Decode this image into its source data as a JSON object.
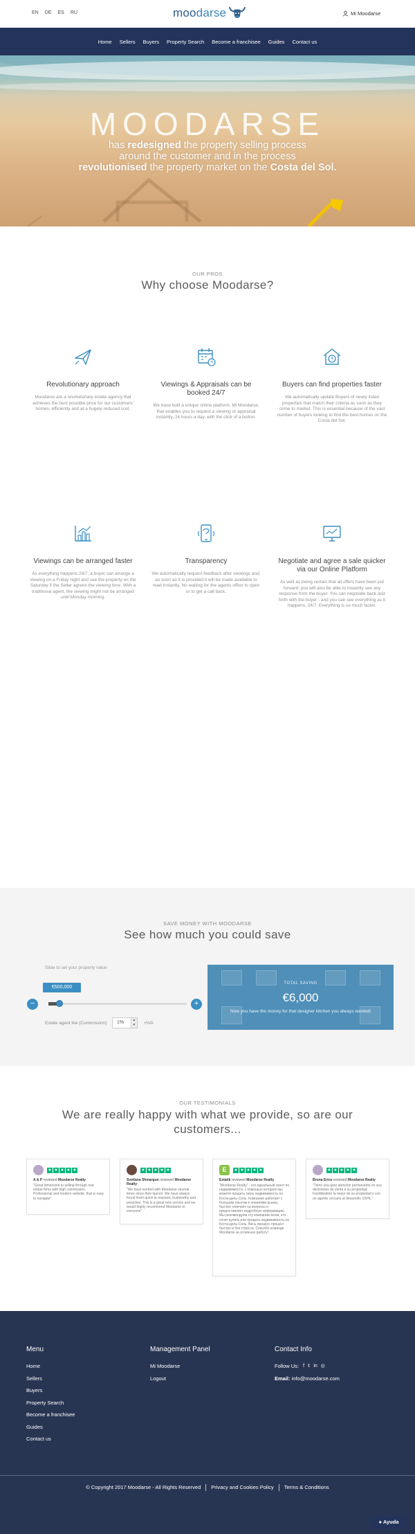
{
  "languages": [
    "EN",
    "DE",
    "ES",
    "RU"
  ],
  "brand": {
    "name_part1": "moo",
    "name_part2": "darse"
  },
  "account_link": "Mi Moodarse",
  "nav": [
    "Home",
    "Sellers",
    "Buyers",
    "Property Search",
    "Become a franchisee",
    "Guides",
    "Contact us"
  ],
  "hero": {
    "title": "MOODARSE",
    "line1_pre": "has ",
    "line1_bold": "redesigned",
    "line1_post": " the property selling process",
    "line2": "around the customer and in the process",
    "line3_bold": "revolutionised",
    "line3_mid": " the property market on the ",
    "line3_bold2": "Costa del Sol."
  },
  "pros": {
    "kicker": "OUR PROS",
    "title": "Why choose Moodarse?",
    "items": [
      {
        "icon": "plane-icon",
        "title": "Revolutionary approach",
        "text": "Moodarse are a revolutionary estate agency that achieves the best possible price for our customers' homes, efficiently and at a hugely reduced cost."
      },
      {
        "icon": "calendar-icon",
        "title": "Viewings & Appraisals can be booked 24/7",
        "text": "We have built a unique online platform, Mi Moodarse, that enables you to request a viewing or appraisal instantly, 24 hours a day, with the click of a button."
      },
      {
        "icon": "house-clock-icon",
        "title": "Buyers can find properties faster",
        "text": "We automatically update Buyers of newly listed properties that match their criteria as soon as they come to market. This is essential because of the vast number of buyers looking to find the best homes on the Costa del Sol."
      },
      {
        "icon": "chart-icon",
        "title": "Viewings can be arranged faster",
        "text": "As everything happens 24/7, a buyer can arrange a viewing on a Friday night and see the property on the Saturday if the Seller agrees the viewing time. With a traditional agent, the viewing might not be arranged until Monday morning."
      },
      {
        "icon": "phone-icon",
        "title": "Transparency",
        "text": "We automatically request feedback after viewings and, as soon as it is provided it will be made available to read instantly. No waiting for the agents office to open or to get a call back."
      },
      {
        "icon": "monitor-icon",
        "title": "Negotiate and agree a sale quicker via our Online Platform",
        "text": "As well as being certain that all offers have been put forward, you will also be able to instantly see any response from the buyer. You can negotiate back and forth with the buyer - and you can see everything as it happens, 24/7. Everything is so much faster."
      }
    ]
  },
  "savings": {
    "kicker": "SAVE MONEY WITH MOODARSE",
    "title": "See how much you could save",
    "slider_label": "Slide to set your property value",
    "property_value": "€500,000",
    "slider_fraction": 0.08,
    "minus": "−",
    "plus": "+",
    "fee_label": "Estate agent fee (Commission)",
    "fee_value": "1%",
    "iva": "+IVA",
    "total_label": "TOTAL SAVING",
    "total_amount": "€6,000",
    "total_caption": "Now you have the money for that designer kitchen you always wanted!"
  },
  "testimonials": {
    "kicker": "OUR TESTIMONIALS",
    "title": "We are really happy with what we provide, so are our customers...",
    "reviewed_word": "reviewed",
    "items": [
      {
        "reviewer": "A & P",
        "company": "Moodarse Realty",
        "avatar_color": "#b9a7c9",
        "text": "\"Great dimension to selling through real estate firms with high commission. Professional and modern website, that is easy to navigate\""
      },
      {
        "reviewer": "Svetlana Shmargun",
        "company": "Moodarse Realty",
        "avatar_color": "#6a4b3f",
        "text": "\"We have worked with Moodarse several times since their launch. We have always found them quick to respond, trustworthy and proactive. This is a great new service and we would highly recommend Moodarse to everyone\""
      },
      {
        "reviewer": "Estatik",
        "company": "Moodarse Realty",
        "avatar_color": "#8bc34a",
        "text": "\"Moodarse Realty\" - это идеальный агент по недвижимости, с помощью которого вы можете продать свою недвижимость на Коста-дель-Соль. Компания работает с большим опытом и знаниями рынка, быстро отвечает на вопросы и предоставляет подробную информацию. Мы рекомендуем эту компанию всем, кто хочет купить или продать недвижимость на Коста-дель-Соль. Весь процесс прошёл быстро и без стресса. Спасибо команде Moodarse за отличную работу!"
      },
      {
        "reviewer": "Bruna Erica",
        "company": "Moodarse Realty",
        "avatar_color": "#b9a7c9",
        "text": "\"Tiene una gran atención permanente en sus decisiones de venta a su propiedad. Facilitándote la mejor de su propiedad y con un agente cercano al desarrollo 100%.\""
      }
    ]
  },
  "footer": {
    "menu_title": "Menu",
    "menu": [
      "Home",
      "Sellers",
      "Buyers",
      "Property Search",
      "Become a franchisee",
      "Guides",
      "Contact us"
    ],
    "panel_title": "Management Panel",
    "panel": [
      "Mi Moodarse",
      "Logout"
    ],
    "contact_title": "Contact Info",
    "follow": "Follow Us:",
    "social_icons": [
      "facebook-icon",
      "twitter-icon",
      "linkedin-icon",
      "instagram-icon"
    ],
    "email_label": "Email:",
    "email": "info@moodarse.com",
    "copyright": "© Copyright 2017 Moodarse - All Rights Reserved",
    "privacy": "Privacy and Cookies Policy",
    "terms": "Terms & Conditions"
  },
  "help_button": "Ayuda",
  "colors": {
    "nav": "#24335a",
    "accent": "#3b8fc4",
    "footer": "#283552",
    "trustpilot": "#00b67a"
  }
}
